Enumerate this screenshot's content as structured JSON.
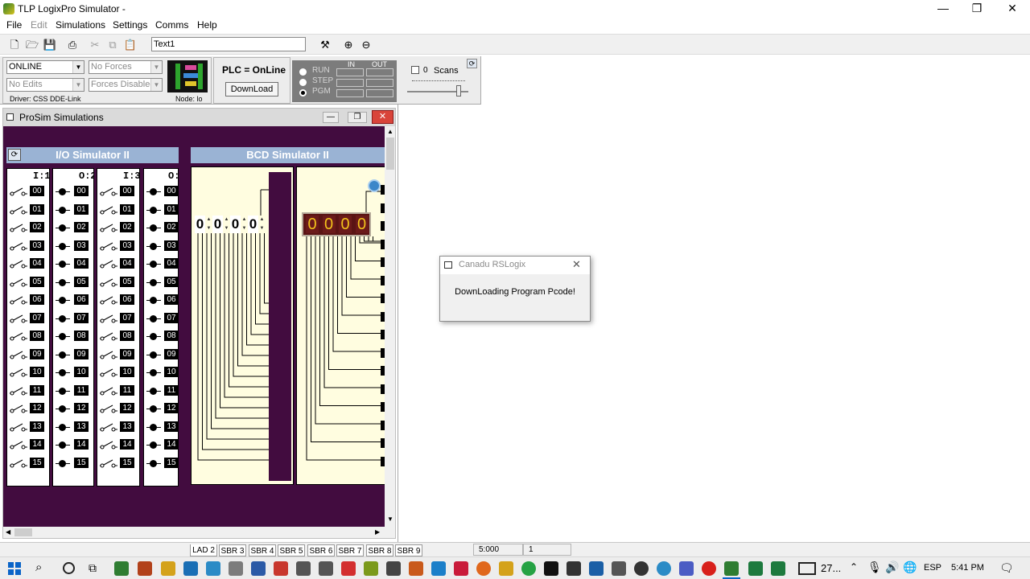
{
  "window": {
    "title": "TLP LogixPro Simulator  -",
    "min": "—",
    "max": "❐",
    "close": "✕"
  },
  "menu": [
    "File",
    "Edit",
    "Simulations",
    "Settings",
    "Comms",
    "Help"
  ],
  "toolbar": {
    "textbox": "Text1"
  },
  "plc": {
    "mode": "ONLINE",
    "forces": "No Forces",
    "edits": "No Edits",
    "forces_enabled": "Forces Disabled",
    "driver": "Driver: CSS DDE-Link",
    "node": "Node: lo",
    "status": "PLC = OnLine",
    "download": "DownLoad",
    "run": "RUN",
    "step": "STEP",
    "pgm": "PGM",
    "in": "IN",
    "out": "OUT",
    "scans_value": "0",
    "scans_label": "Scans"
  },
  "prosim": {
    "title": "ProSim Simulations",
    "io_title": "I/O Simulator II",
    "bcd_title": "BCD Simulator II",
    "columns": [
      "I:1",
      "O:2",
      "I:3",
      "O:"
    ],
    "slots": [
      "00",
      "01",
      "02",
      "03",
      "04",
      "05",
      "06",
      "07",
      "08",
      "09",
      "10",
      "11",
      "12",
      "13",
      "14",
      "15"
    ],
    "bcd_in_digits": [
      "0",
      "0",
      "0",
      "0"
    ],
    "bcd_out_digits": [
      "0",
      "0",
      "0",
      "0"
    ]
  },
  "dialog": {
    "title": "Canadu RSLogix",
    "message": "DownLoading Program Pcode!"
  },
  "status": {
    "tabs": [
      "LAD 2",
      "SBR 3",
      "SBR 4",
      "SBR 5",
      "SBR 6",
      "SBR 7",
      "SBR 8",
      "SBR 9"
    ],
    "address": "5:000",
    "value": "1"
  },
  "taskbar": {
    "app_label": "27...",
    "lang": "ESP",
    "time": "5:41 PM"
  }
}
